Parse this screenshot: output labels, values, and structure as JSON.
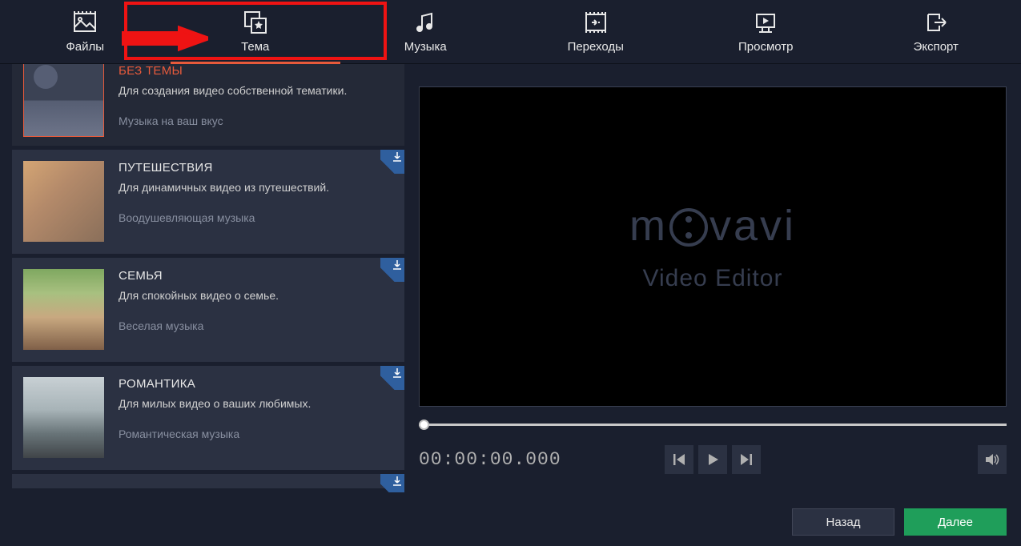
{
  "nav": {
    "files": "Файлы",
    "theme": "Тема",
    "music": "Музыка",
    "transitions": "Переходы",
    "preview": "Просмотр",
    "export": "Экспорт"
  },
  "themes": [
    {
      "title": "БЕЗ ТЕМЫ",
      "desc": "Для создания видео собственной тематики.",
      "music": "Музыка на ваш вкус",
      "selected": true,
      "downloadable": false
    },
    {
      "title": "ПУТЕШЕСТВИЯ",
      "desc": "Для динамичных видео из путешествий.",
      "music": "Воодушевляющая музыка",
      "selected": false,
      "downloadable": true
    },
    {
      "title": "СЕМЬЯ",
      "desc": "Для спокойных видео о семье.",
      "music": "Веселая музыка",
      "selected": false,
      "downloadable": true
    },
    {
      "title": "РОМАНТИКА",
      "desc": "Для милых видео о ваших любимых.",
      "music": "Романтическая музыка",
      "selected": false,
      "downloadable": true
    }
  ],
  "preview": {
    "brand_prefix": "m",
    "brand_suffix": "vavi",
    "brand_sub": "Video Editor",
    "timecode": "00:00:00.000"
  },
  "footer": {
    "back": "Назад",
    "next": "Далее"
  }
}
